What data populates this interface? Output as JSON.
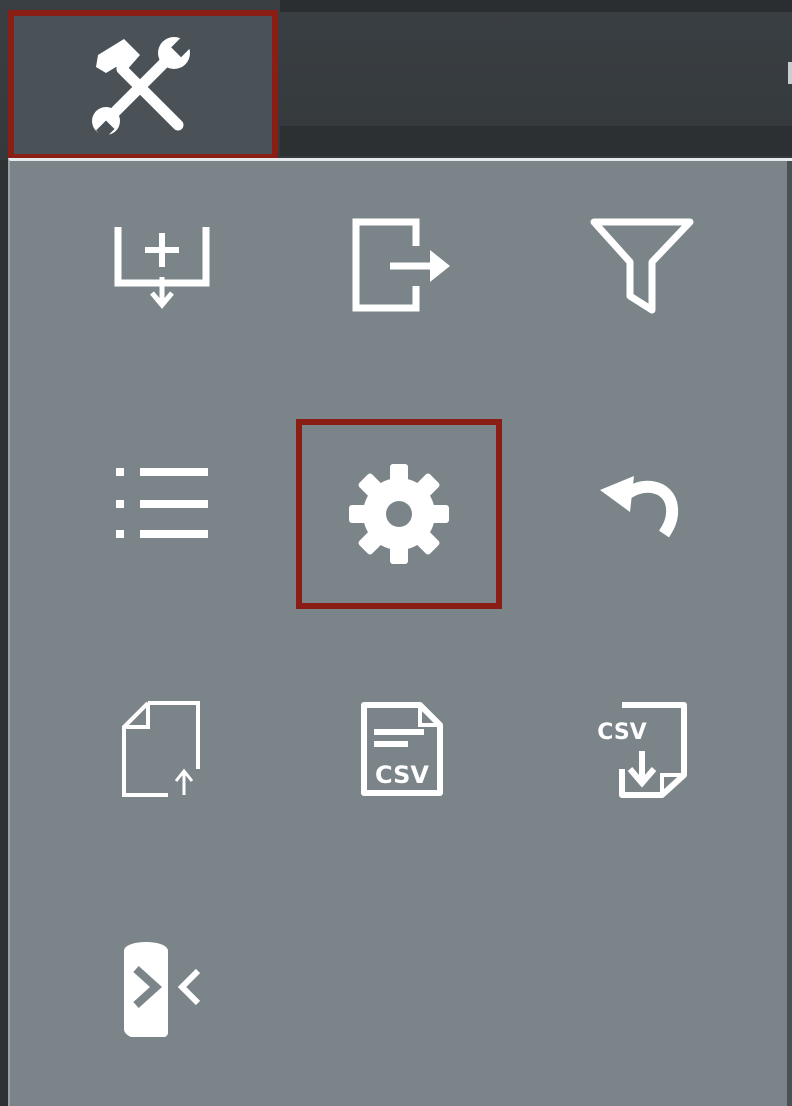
{
  "toolbar": {
    "tools_button": {
      "icon": "tools-icon"
    }
  },
  "menu": {
    "items": [
      {
        "id": "import",
        "icon": "import-icon"
      },
      {
        "id": "export",
        "icon": "export-icon"
      },
      {
        "id": "filter",
        "icon": "filter-icon"
      },
      {
        "id": "list",
        "icon": "list-icon"
      },
      {
        "id": "settings",
        "icon": "gear-icon",
        "highlighted": true
      },
      {
        "id": "undo",
        "icon": "undo-icon"
      },
      {
        "id": "upload-file",
        "icon": "file-upload-icon"
      },
      {
        "id": "csv-file",
        "icon": "csv-file-icon",
        "text": "CSV"
      },
      {
        "id": "csv-download",
        "icon": "csv-download-icon",
        "text": "CSV"
      },
      {
        "id": "exchange",
        "icon": "exchange-icon"
      }
    ]
  },
  "colors": {
    "panel_background": "#7b8488",
    "toolbar_background": "#3a3f43",
    "highlight_border": "#8b1e14",
    "icon_color": "#ffffff"
  }
}
